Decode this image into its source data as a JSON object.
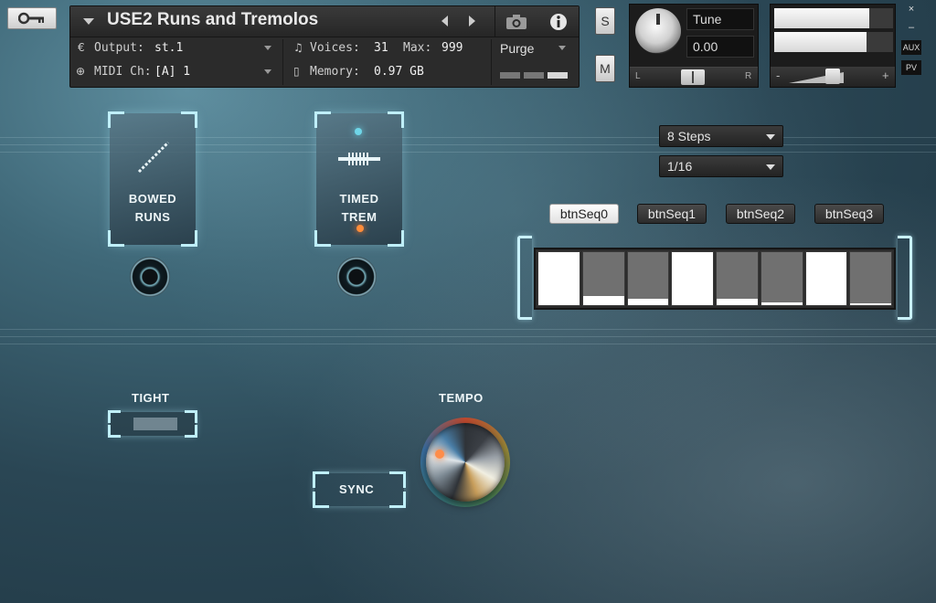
{
  "header": {
    "instrument_title": "USE2 Runs and Tremolos",
    "output_label": "Output:",
    "output_value": "st.1",
    "voices_label": "Voices:",
    "voices_value": "31",
    "max_label": "Max:",
    "max_value": "999",
    "purge_label": "Purge",
    "midi_label": "MIDI Ch:",
    "midi_value": "[A]  1",
    "memory_label": "Memory:",
    "memory_value": "0.97 GB",
    "solo_label": "S",
    "mute_label": "M",
    "tune_label": "Tune",
    "tune_value": "0.00",
    "pan_left": "L",
    "pan_right": "R",
    "vol_minus": "-",
    "vol_plus": "+",
    "close_glyph": "×",
    "minimize_glyph": "–",
    "aux_label": "AUX",
    "pv_label": "PV",
    "meter_levels": [
      0.8,
      0.78
    ]
  },
  "articulations": [
    {
      "line1": "BOWED",
      "line2": "RUNS"
    },
    {
      "line1": "TIMED",
      "line2": "TREM"
    }
  ],
  "sequencer": {
    "steps_dropdown": "8 Steps",
    "rate_dropdown": "1/16",
    "buttons": [
      "btnSeq0",
      "btnSeq1",
      "btnSeq2",
      "btnSeq3"
    ],
    "active_button": 0,
    "step_values": [
      1.0,
      0.18,
      0.12,
      1.0,
      0.12,
      0.05,
      1.0,
      0.03
    ]
  },
  "controls": {
    "tight_label": "TIGHT",
    "tempo_label": "TEMPO",
    "sync_label": "SYNC"
  },
  "icons": {
    "wrench": "wrench-icon",
    "camera": "camera-icon",
    "info": "info-icon",
    "output": "output-icon",
    "voices": "voices-icon",
    "midi": "midi-icon",
    "memory": "memory-icon"
  }
}
